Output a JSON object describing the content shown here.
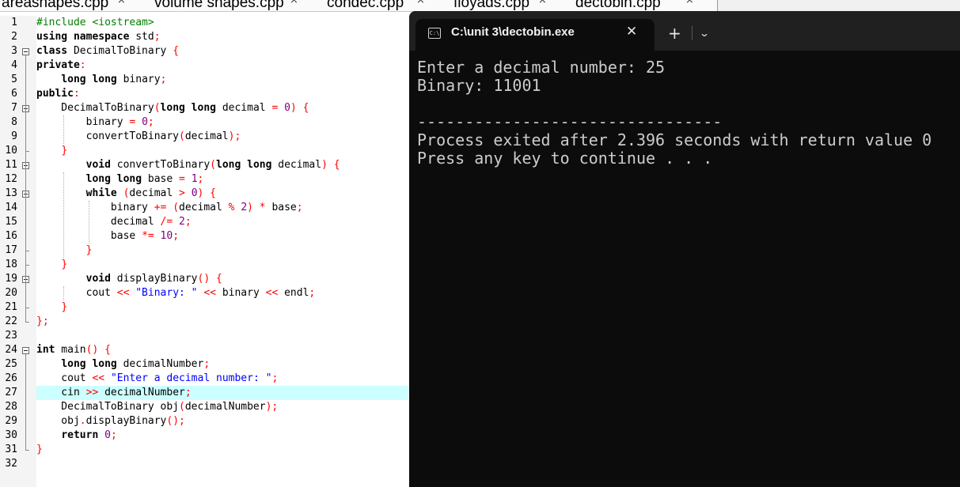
{
  "editor_tabs": [
    {
      "label": "areashapes.cpp"
    },
    {
      "label": "volume shapes.cpp"
    },
    {
      "label": "condec.cpp"
    },
    {
      "label": "floyads.cpp"
    },
    {
      "label": "dectobin.cpp"
    }
  ],
  "tab_close_glyph": "×",
  "line_numbers": [
    "1",
    "2",
    "3",
    "4",
    "5",
    "6",
    "7",
    "8",
    "9",
    "10",
    "11",
    "12",
    "13",
    "14",
    "15",
    "16",
    "17",
    "18",
    "19",
    "20",
    "21",
    "22",
    "23",
    "24",
    "25",
    "26",
    "27",
    "28",
    "29",
    "30",
    "31",
    "32"
  ],
  "code_lines": [
    [
      {
        "t": "#include <iostream>",
        "c": "pp"
      }
    ],
    [
      {
        "t": "using namespace",
        "c": "kw"
      },
      {
        "t": " std"
      },
      {
        "t": ";",
        "c": "op"
      }
    ],
    [
      {
        "t": "class",
        "c": "kw"
      },
      {
        "t": " DecimalToBinary "
      },
      {
        "t": "{",
        "c": "op"
      }
    ],
    [
      {
        "t": "private",
        "c": "kw"
      },
      {
        "t": ":",
        "c": "op"
      }
    ],
    [
      {
        "t": "    "
      },
      {
        "t": "long long",
        "c": "kw"
      },
      {
        "t": " binary"
      },
      {
        "t": ";",
        "c": "op"
      }
    ],
    [
      {
        "t": "public",
        "c": "kw"
      },
      {
        "t": ":",
        "c": "op"
      }
    ],
    [
      {
        "t": "    DecimalToBinary"
      },
      {
        "t": "(",
        "c": "op"
      },
      {
        "t": "long long",
        "c": "kw"
      },
      {
        "t": " decimal "
      },
      {
        "t": "=",
        "c": "op"
      },
      {
        "t": " "
      },
      {
        "t": "0",
        "c": "num"
      },
      {
        "t": ") {",
        "c": "op"
      }
    ],
    [
      {
        "t": "        binary "
      },
      {
        "t": "=",
        "c": "op"
      },
      {
        "t": " "
      },
      {
        "t": "0",
        "c": "num"
      },
      {
        "t": ";",
        "c": "op"
      }
    ],
    [
      {
        "t": "        convertToBinary"
      },
      {
        "t": "(",
        "c": "op"
      },
      {
        "t": "decimal"
      },
      {
        "t": ");",
        "c": "op"
      }
    ],
    [
      {
        "t": "    "
      },
      {
        "t": "}",
        "c": "op"
      }
    ],
    [
      {
        "t": "        "
      },
      {
        "t": "void",
        "c": "kw"
      },
      {
        "t": " convertToBinary"
      },
      {
        "t": "(",
        "c": "op"
      },
      {
        "t": "long long",
        "c": "kw"
      },
      {
        "t": " decimal"
      },
      {
        "t": ") {",
        "c": "op"
      }
    ],
    [
      {
        "t": "        "
      },
      {
        "t": "long long",
        "c": "kw"
      },
      {
        "t": " base "
      },
      {
        "t": "=",
        "c": "op"
      },
      {
        "t": " "
      },
      {
        "t": "1",
        "c": "num"
      },
      {
        "t": ";",
        "c": "op"
      }
    ],
    [
      {
        "t": "        "
      },
      {
        "t": "while",
        "c": "kw"
      },
      {
        "t": " "
      },
      {
        "t": "(",
        "c": "op"
      },
      {
        "t": "decimal "
      },
      {
        "t": ">",
        "c": "op"
      },
      {
        "t": " "
      },
      {
        "t": "0",
        "c": "num"
      },
      {
        "t": ") {",
        "c": "op"
      }
    ],
    [
      {
        "t": "            binary "
      },
      {
        "t": "+=",
        "c": "op"
      },
      {
        "t": " "
      },
      {
        "t": "(",
        "c": "op"
      },
      {
        "t": "decimal "
      },
      {
        "t": "%",
        "c": "op"
      },
      {
        "t": " "
      },
      {
        "t": "2",
        "c": "num"
      },
      {
        "t": ")",
        "c": "op"
      },
      {
        "t": " "
      },
      {
        "t": "*",
        "c": "op"
      },
      {
        "t": " base"
      },
      {
        "t": ";",
        "c": "op"
      }
    ],
    [
      {
        "t": "            decimal "
      },
      {
        "t": "/=",
        "c": "op"
      },
      {
        "t": " "
      },
      {
        "t": "2",
        "c": "num"
      },
      {
        "t": ";",
        "c": "op"
      }
    ],
    [
      {
        "t": "            base "
      },
      {
        "t": "*=",
        "c": "op"
      },
      {
        "t": " "
      },
      {
        "t": "10",
        "c": "num"
      },
      {
        "t": ";",
        "c": "op"
      }
    ],
    [
      {
        "t": "        "
      },
      {
        "t": "}",
        "c": "op"
      }
    ],
    [
      {
        "t": "    "
      },
      {
        "t": "}",
        "c": "op"
      }
    ],
    [
      {
        "t": "        "
      },
      {
        "t": "void",
        "c": "kw"
      },
      {
        "t": " displayBinary"
      },
      {
        "t": "() {",
        "c": "op"
      }
    ],
    [
      {
        "t": "        cout "
      },
      {
        "t": "<<",
        "c": "op"
      },
      {
        "t": " "
      },
      {
        "t": "\"Binary: \"",
        "c": "str"
      },
      {
        "t": " "
      },
      {
        "t": "<<",
        "c": "op"
      },
      {
        "t": " binary "
      },
      {
        "t": "<<",
        "c": "op"
      },
      {
        "t": " endl"
      },
      {
        "t": ";",
        "c": "op"
      }
    ],
    [
      {
        "t": "    "
      },
      {
        "t": "}",
        "c": "op"
      }
    ],
    [
      {
        "t": "};",
        "c": "op"
      }
    ],
    [],
    [
      {
        "t": "int",
        "c": "kw"
      },
      {
        "t": " main"
      },
      {
        "t": "() {",
        "c": "op"
      }
    ],
    [
      {
        "t": "    "
      },
      {
        "t": "long long",
        "c": "kw"
      },
      {
        "t": " decimalNumber"
      },
      {
        "t": ";",
        "c": "op"
      }
    ],
    [
      {
        "t": "    cout "
      },
      {
        "t": "<<",
        "c": "op"
      },
      {
        "t": " "
      },
      {
        "t": "\"Enter a decimal number: \"",
        "c": "str"
      },
      {
        "t": ";",
        "c": "op"
      }
    ],
    [
      {
        "t": "    cin "
      },
      {
        "t": ">>",
        "c": "op"
      },
      {
        "t": " decimalNumber"
      },
      {
        "t": ";",
        "c": "op"
      }
    ],
    [
      {
        "t": "    DecimalToBinary obj"
      },
      {
        "t": "(",
        "c": "op"
      },
      {
        "t": "decimalNumber"
      },
      {
        "t": ");",
        "c": "op"
      }
    ],
    [
      {
        "t": "    obj"
      },
      {
        "t": ".",
        "c": "op"
      },
      {
        "t": "displayBinary"
      },
      {
        "t": "();",
        "c": "op"
      }
    ],
    [
      {
        "t": "    "
      },
      {
        "t": "return",
        "c": "kw"
      },
      {
        "t": " "
      },
      {
        "t": "0",
        "c": "num"
      },
      {
        "t": ";",
        "c": "op"
      }
    ],
    [
      {
        "t": "}",
        "c": "op"
      }
    ],
    []
  ],
  "highlighted_line": 27,
  "terminal": {
    "icon_text": "C:\\",
    "title": "C:\\unit 3\\dectobin.exe",
    "close_glyph": "✕",
    "new_tab_glyph": "+",
    "dropdown_glyph": "⌄",
    "lines": [
      "Enter a decimal number: 25",
      "Binary: 11001",
      "",
      "--------------------------------",
      "Process exited after 2.396 seconds with return value 0",
      "Press any key to continue . . ."
    ]
  }
}
